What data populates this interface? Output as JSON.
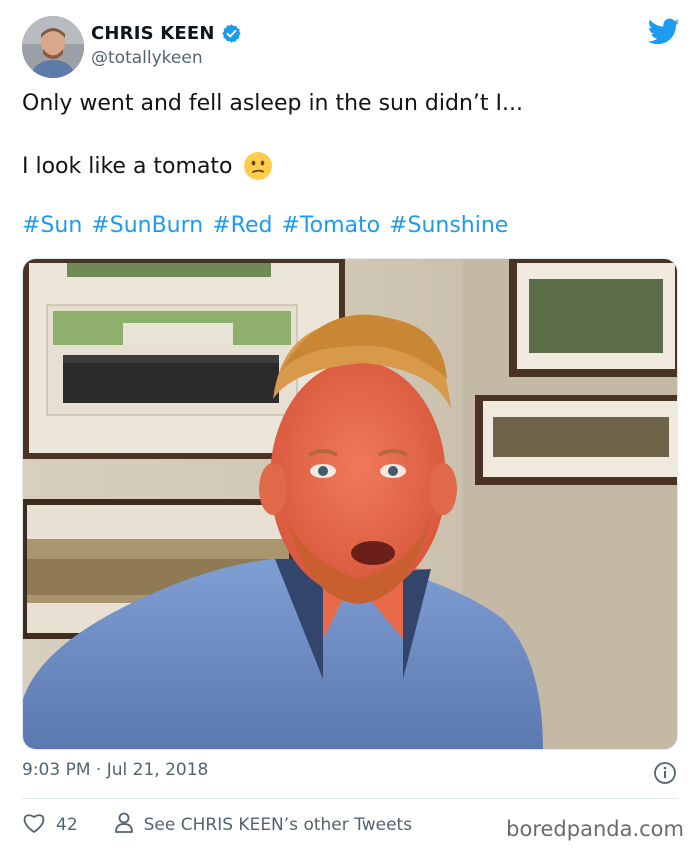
{
  "tweet": {
    "author_name": "CHRIS KEEN",
    "author_handle": "@totallykeen",
    "text_line1": "Only went and fell asleep in the sun didn’t I...",
    "text_line2": "I look like a tomato",
    "hashtags": [
      "#Sun",
      "#SunBurn",
      "#Red",
      "#Tomato",
      "#Sunshine"
    ],
    "timestamp": "9:03 PM · Jul 21, 2018",
    "like_count": "42",
    "other_tweets_label": "See CHRIS KEEN’s other Tweets"
  },
  "icons": {
    "verified": "verified-badge-icon",
    "brand": "twitter-bird-icon",
    "emoji": "confused-face-emoji",
    "info": "info-icon",
    "like": "heart-icon",
    "profile": "person-icon"
  },
  "colors": {
    "link": "#1d9bf0",
    "secondary_text": "#536471",
    "primary_text": "#0f1419"
  },
  "watermark": "boredpanda.com"
}
